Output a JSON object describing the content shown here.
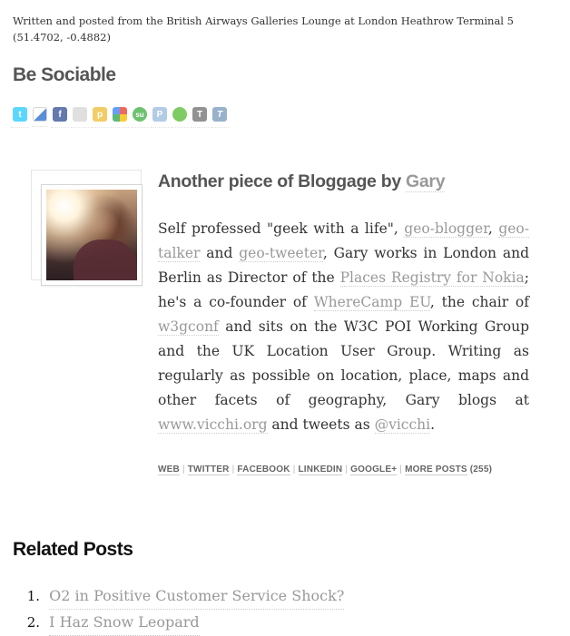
{
  "posted": "Written and posted from the British Airways Galleries Lounge at London Heathrow Terminal 5 (51.4702, -0.4882)",
  "sociable": {
    "title": "Be Sociable",
    "icons": [
      {
        "name": "twitter-icon",
        "glyph": "t",
        "color": "#33ccff"
      },
      {
        "name": "delicious-icon",
        "glyph": "",
        "color": "#3274d1"
      },
      {
        "name": "facebook-icon",
        "glyph": "f",
        "color": "#3b5998"
      },
      {
        "name": "myspace-icon",
        "glyph": "",
        "color": "#b8b8b8"
      },
      {
        "name": "ping-icon",
        "glyph": "p",
        "color": "#f0c040"
      },
      {
        "name": "google-icon",
        "glyph": "",
        "color": "#4285f4"
      },
      {
        "name": "stumbleupon-icon",
        "glyph": "su",
        "color": "#4ab34c"
      },
      {
        "name": "posterous-icon",
        "glyph": "P",
        "color": "#a0c0e0"
      },
      {
        "name": "orkut-icon",
        "glyph": "",
        "color": "#5fbf3f"
      },
      {
        "name": "technorati-icon",
        "glyph": "T",
        "color": "#777777"
      },
      {
        "name": "tumblr-icon",
        "glyph": "T",
        "color": "#7fa0c0"
      }
    ]
  },
  "author": {
    "title_prefix": "Another piece of Bloggage by ",
    "name": "Gary",
    "bio": {
      "t1": "Self professed \"geek with a life\", ",
      "l1": "geo-blogger",
      "t2": ", ",
      "l2": "geo-talker",
      "t3": " and ",
      "l3": "geo-tweeter",
      "t4": ", Gary works in London and Berlin as Director of the ",
      "l4": "Places Registry for Nokia",
      "t5": "; he's a co-founder of ",
      "l5": "WhereCamp EU",
      "t6": ", the chair of ",
      "l6": "w3gconf",
      "t7": " and sits on the W3C POI Working Group and the UK Location User Group. Writing as regularly as possible on location, place, maps and other facets of geography, Gary blogs at ",
      "l7": "www.vicchi.org",
      "t8": " and tweets as ",
      "l8": "@vicchi",
      "t9": "."
    },
    "links": {
      "web": "WEB",
      "twitter": "TWITTER",
      "facebook": "FACEBOOK",
      "linkedin": "LINKEDIN",
      "googleplus": "GOOGLE+",
      "more": "MORE POSTS",
      "count": "(255)",
      "separator": "|"
    }
  },
  "related": {
    "title": "Related Posts",
    "items": [
      {
        "number": "1.",
        "label": "O2 in Positive Customer Service Shock?"
      },
      {
        "number": "2.",
        "label": "I Haz Snow Leopard"
      }
    ]
  }
}
